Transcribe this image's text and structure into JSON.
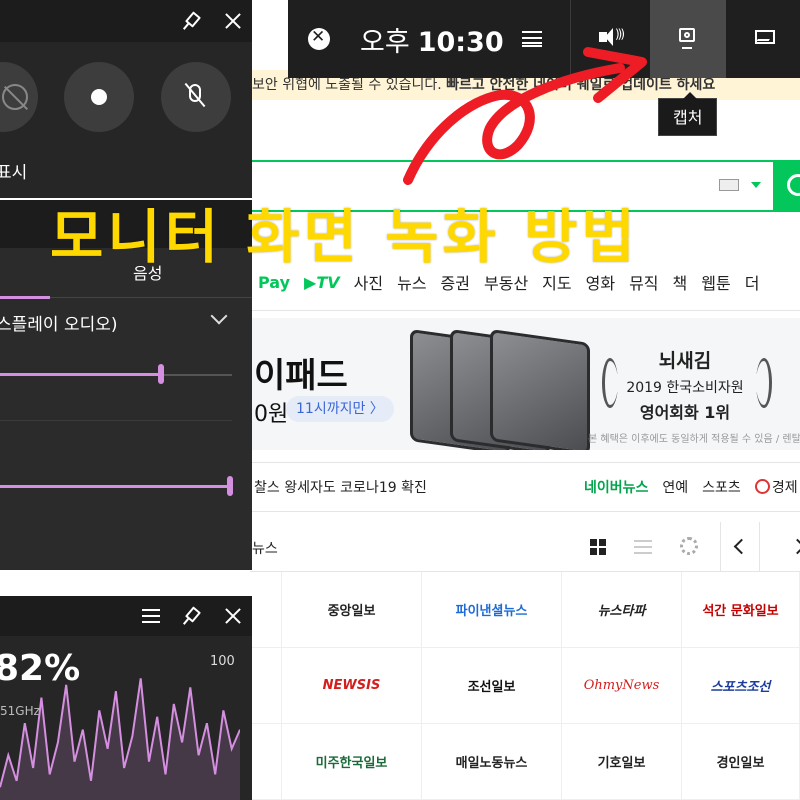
{
  "notice": {
    "text": "보안 위협에 노출될 수 있습니다.",
    "bold_text": "빠르고 안전한 네이버 웨일로 업데이트 하세요"
  },
  "service_nav": [
    "Pay",
    "▶TV",
    "사진",
    "뉴스",
    "증권",
    "부동산",
    "지도",
    "영화",
    "뮤직",
    "책",
    "웹툰",
    "더"
  ],
  "banner": {
    "title": "이패드",
    "price_fragment": "0원",
    "time_pill": "11시까지만 〉",
    "award_title": "뇌새김",
    "award_sub": "2019 한국소비자원",
    "award_rank": "영어회화 1위",
    "fineprint": "본 혜택은 이후에도 동일하게 적용될 수 있음 / 렌탈"
  },
  "news": {
    "headline": "찰스 왕세자도 코로나19 확진",
    "tabs": [
      "네이버뉴스",
      "연예",
      "스포츠",
      "경제"
    ]
  },
  "press": {
    "header_label": "뉴스",
    "rows": [
      [
        "",
        "중앙일보",
        "파이낸셜뉴스",
        "뉴스타파",
        "석간 문화일보"
      ],
      [
        "",
        "NEWSIS",
        "조선일보",
        "OhmyNews",
        "스포츠조선"
      ],
      [
        "",
        "미주한국일보",
        "매일노동뉴스",
        "기호일보",
        "경인일보"
      ]
    ]
  },
  "gamebar": {
    "clock_ampm": "오후",
    "clock_time": "10:30",
    "tools": [
      "audio",
      "capture",
      "performance"
    ],
    "capture_tooltip": "캡처"
  },
  "capture_widget": {
    "show_label": "표시"
  },
  "audio_widget": {
    "tab_voice": "음성",
    "device_label": "스플레이 오디오)",
    "slider1_level": 0.69,
    "slider2_level": 1.0
  },
  "perf_widget": {
    "percent": "82%",
    "freq": "51GHz",
    "max_label": "100",
    "graph_values": [
      10,
      35,
      15,
      60,
      25,
      80,
      20,
      45,
      90,
      30,
      55,
      15,
      70,
      40,
      85,
      25,
      50,
      95,
      30,
      65,
      20,
      75,
      45,
      88,
      35,
      60,
      20,
      70,
      40,
      55
    ]
  },
  "overlay": {
    "title": "모니터 화면 녹화 방법"
  },
  "colors": {
    "naver_green": "#03c75a",
    "overlay_yellow": "#ffd800",
    "accent_pink": "#d58fe0",
    "arrow_red": "#ee1c25"
  }
}
